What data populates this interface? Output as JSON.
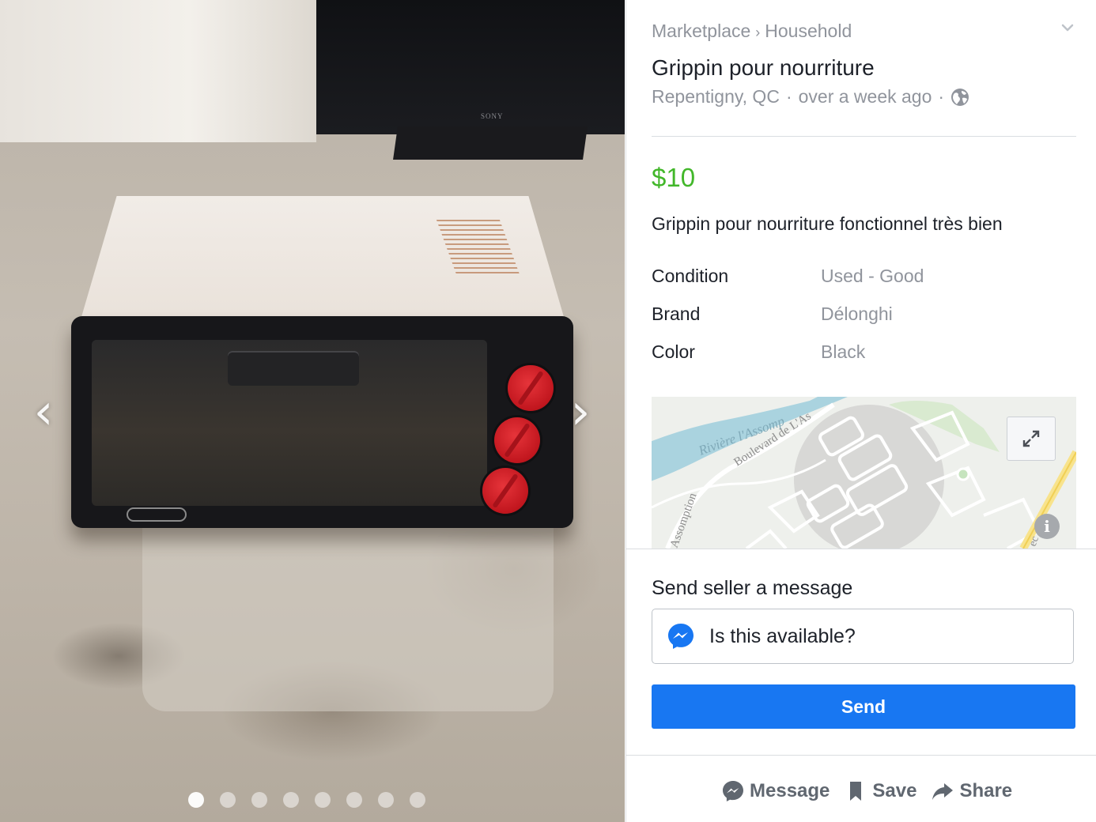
{
  "gallery": {
    "prev_arrow": "‹",
    "next_arrow": "›",
    "photo_count": 8,
    "active_photo_index": 0,
    "brand_on_tv": "SONY"
  },
  "listing": {
    "breadcrumb": [
      "Marketplace",
      "Household"
    ],
    "breadcrumb_separator": "›",
    "title": "Grippin pour nourriture",
    "location": "Repentigny, QC",
    "posted": "over a week ago",
    "meta_separator": "·",
    "price": "$10",
    "description": "Grippin pour nourriture fonctionnel très bien",
    "attributes": [
      {
        "key": "Condition",
        "value": "Used - Good"
      },
      {
        "key": "Brand",
        "value": "Délonghi"
      },
      {
        "key": "Color",
        "value": "Black"
      }
    ]
  },
  "map": {
    "labels": [
      "Rivière l'Assomp",
      "Boulevard de L'As",
      "Assomption",
      "ec"
    ],
    "info_glyph": "i"
  },
  "message": {
    "label": "Send seller a message",
    "input_value": "Is this available?",
    "send_label": "Send"
  },
  "actions": [
    {
      "label": "Message",
      "icon": "messenger-bubble-icon"
    },
    {
      "label": "Save",
      "icon": "bookmark-icon"
    },
    {
      "label": "Share",
      "icon": "share-arrow-icon"
    }
  ],
  "colors": {
    "price": "#42b72a",
    "send_button": "#1877f2",
    "muted_text": "#90949c"
  }
}
